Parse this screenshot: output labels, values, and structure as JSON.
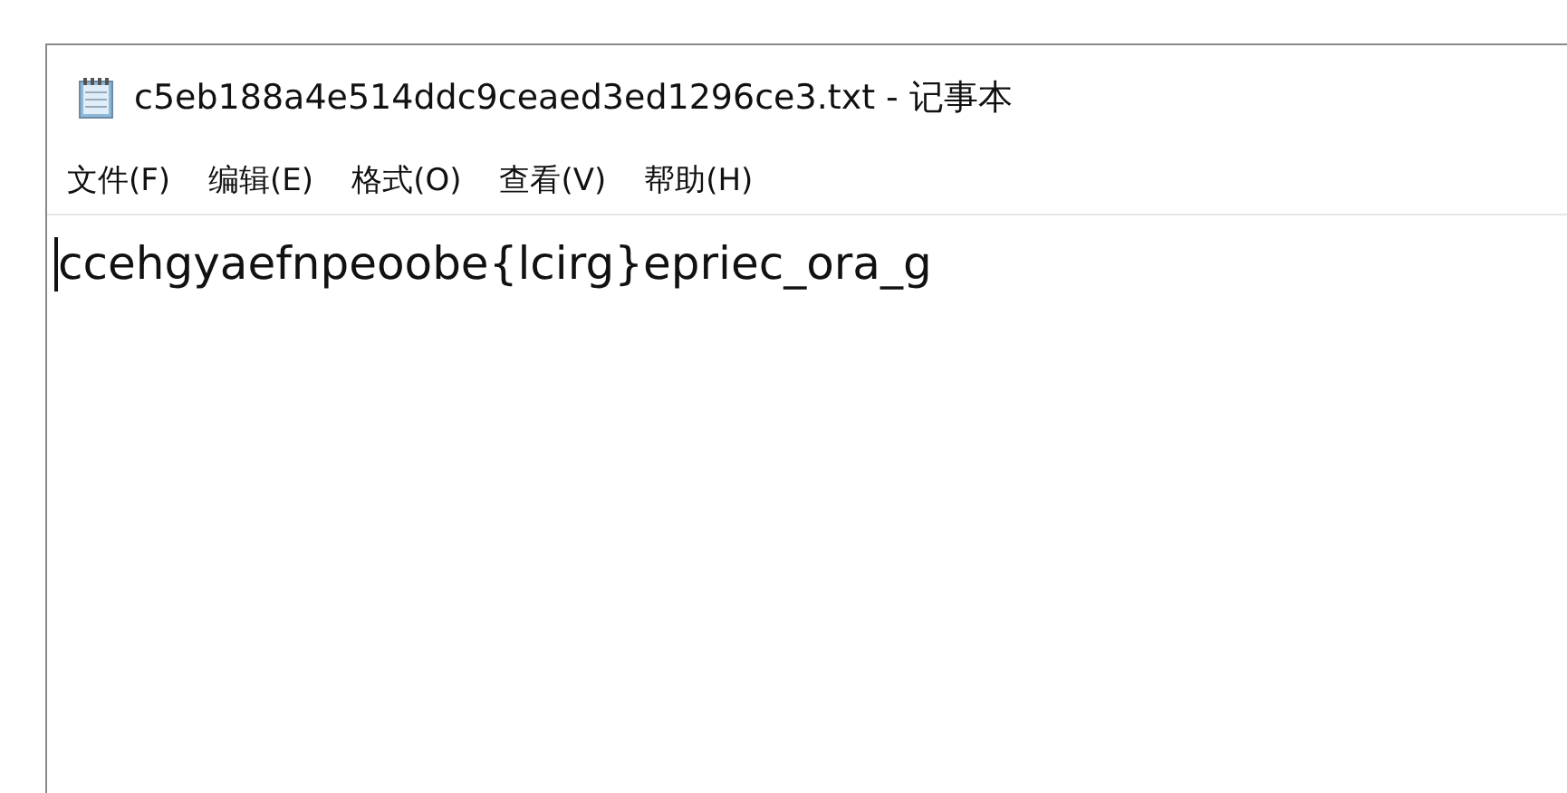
{
  "window": {
    "title": "c5eb188a4e514ddc9ceaed3ed1296ce3.txt - 记事本"
  },
  "menu": [
    "文件(F)",
    "编辑(E)",
    "格式(O)",
    "查看(V)",
    "帮助(H)"
  ],
  "editor": {
    "text": "ccehgyaefnpeoobe{lcirg}epriec_ora_g"
  }
}
